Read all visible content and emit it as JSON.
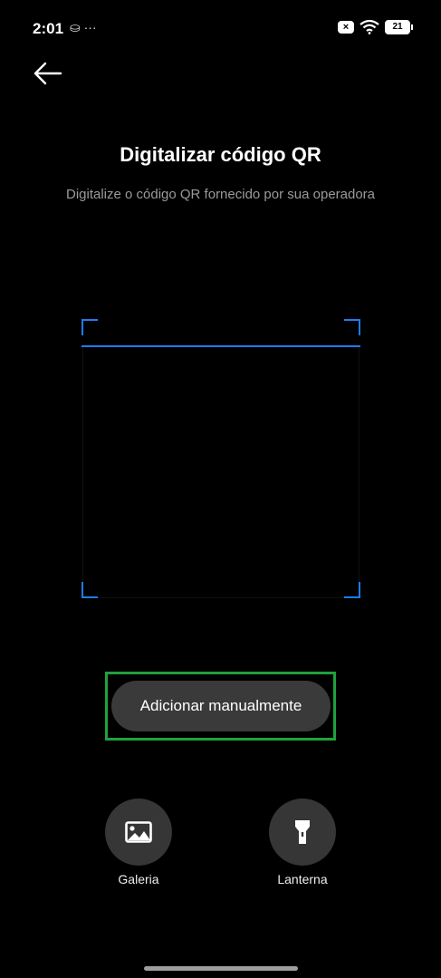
{
  "status_bar": {
    "time": "2:01",
    "left_icons": "⛀ ···",
    "sim_badge": "×",
    "battery_level": "21"
  },
  "header": {
    "title": "Digitalizar código QR",
    "subtitle": "Digitalize o código QR fornecido por sua operadora"
  },
  "scanner": {
    "frame_color": "#1e7bf2"
  },
  "actions": {
    "manual_label": "Adicionar manualmente",
    "highlight_color": "#1fa13e",
    "gallery_label": "Galeria",
    "gallery_icon": "image-icon",
    "torch_label": "Lanterna",
    "torch_icon": "flashlight-icon"
  }
}
